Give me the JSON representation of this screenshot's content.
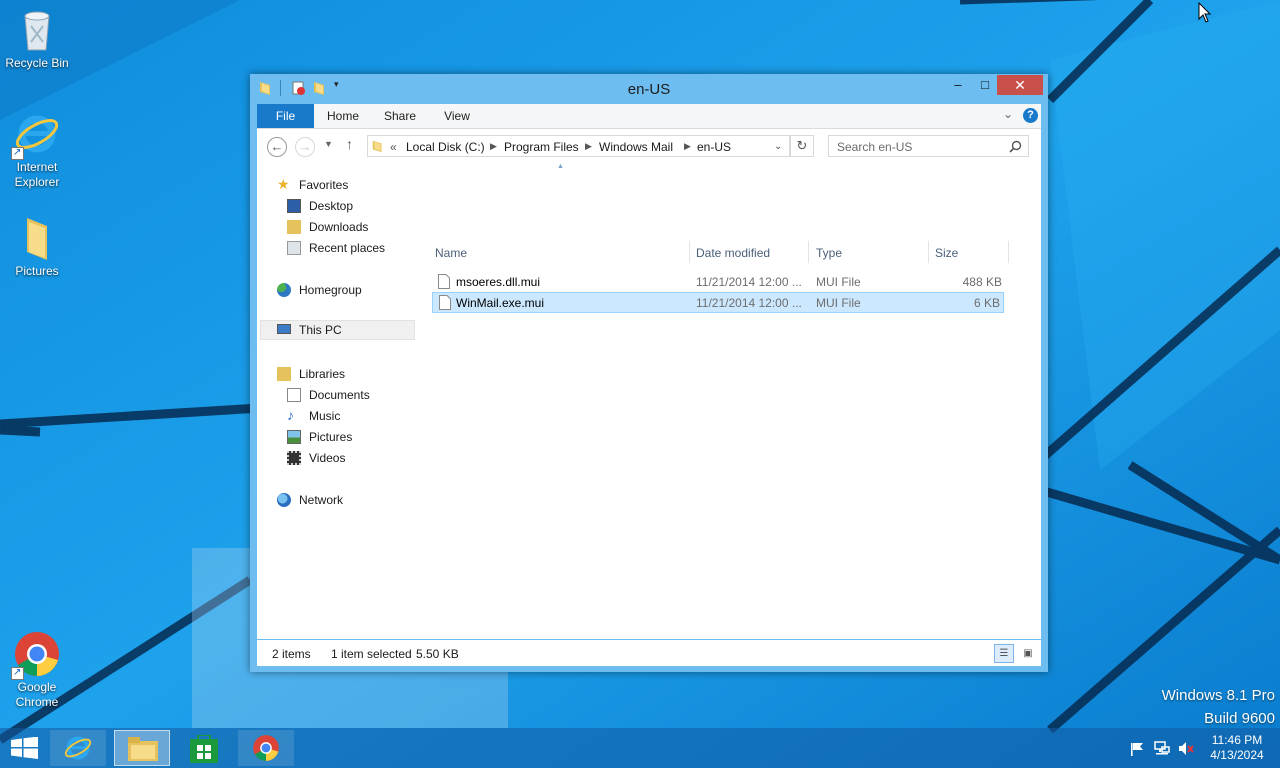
{
  "desktop": {
    "icons": [
      {
        "label": "Recycle Bin"
      },
      {
        "label": "Internet Explorer"
      },
      {
        "label": "Pictures"
      },
      {
        "label": "Google Chrome"
      }
    ],
    "os_name": "Windows 8.1 Pro",
    "os_build": "Build 9600"
  },
  "window": {
    "title": "en-US",
    "controls": {
      "minimize": "–",
      "maximize": "□",
      "close": "✕"
    },
    "ribbon_tabs": [
      "File",
      "Home",
      "Share",
      "View"
    ],
    "address": {
      "overflow": "«",
      "crumbs": [
        "Local Disk (C:)",
        "Program Files",
        "Windows Mail",
        "en-US"
      ]
    },
    "search_placeholder": "Search en-US",
    "nav": {
      "favorites": "Favorites",
      "desktop": "Desktop",
      "downloads": "Downloads",
      "recent": "Recent places",
      "homegroup": "Homegroup",
      "thispc": "This PC",
      "libraries": "Libraries",
      "documents": "Documents",
      "music": "Music",
      "pictures": "Pictures",
      "videos": "Videos",
      "network": "Network"
    },
    "columns": [
      "Name",
      "Date modified",
      "Type",
      "Size"
    ],
    "files": [
      {
        "name": "msoeres.dll.mui",
        "date": "11/21/2014 12:00 ...",
        "type": "MUI File",
        "size": "488 KB"
      },
      {
        "name": "WinMail.exe.mui",
        "date": "11/21/2014 12:00 ...",
        "type": "MUI File",
        "size": "6 KB"
      }
    ],
    "status": {
      "count": "2 items",
      "selected": "1 item selected",
      "size": "5.50 KB"
    }
  },
  "taskbar": {
    "time": "11:46 PM",
    "date": "4/13/2024"
  },
  "colors": {
    "desktop": "#1690e0",
    "window_frame": "#6ebdf0",
    "file_tab": "#1979ca",
    "selection": "#cce8ff",
    "close": "#c7504a"
  }
}
